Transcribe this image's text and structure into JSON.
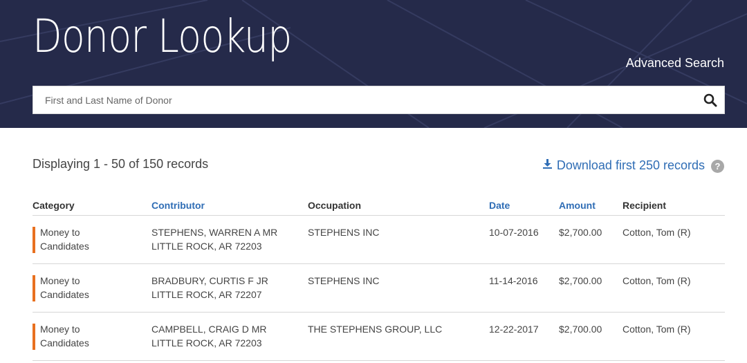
{
  "header": {
    "title": "Donor Lookup",
    "advanced_search": "Advanced Search",
    "search_placeholder": "First and Last Name of Donor",
    "search_value": ""
  },
  "summary": {
    "records_text": "Displaying 1 - 50 of 150 records",
    "download_text": "Download first 250 records",
    "help": "?"
  },
  "table": {
    "columns": {
      "category": "Category",
      "contributor": "Contributor",
      "occupation": "Occupation",
      "date": "Date",
      "amount": "Amount",
      "recipient": "Recipient"
    },
    "rows": [
      {
        "category_line1": "Money to",
        "category_line2": "Candidates",
        "contributor_name": "STEPHENS, WARREN A MR",
        "contributor_location": "LITTLE ROCK, AR 72203",
        "occupation": "STEPHENS INC",
        "date": "10-07-2016",
        "amount": "$2,700.00",
        "recipient": "Cotton, Tom (R)"
      },
      {
        "category_line1": "Money to",
        "category_line2": "Candidates",
        "contributor_name": "BRADBURY, CURTIS F JR",
        "contributor_location": "LITTLE ROCK, AR 72207",
        "occupation": "STEPHENS INC",
        "date": "11-14-2016",
        "amount": "$2,700.00",
        "recipient": "Cotton, Tom (R)"
      },
      {
        "category_line1": "Money to",
        "category_line2": "Candidates",
        "contributor_name": "CAMPBELL, CRAIG D MR",
        "contributor_location": "LITTLE ROCK, AR 72203",
        "occupation": "THE STEPHENS GROUP, LLC",
        "date": "12-22-2017",
        "amount": "$2,700.00",
        "recipient": "Cotton, Tom (R)"
      }
    ]
  },
  "colors": {
    "header_bg": "#252a4a",
    "link": "#2f6db5",
    "category_accent": "#e8701f"
  },
  "icons": {
    "search": "search-icon",
    "download": "download-icon",
    "help": "help-icon"
  }
}
